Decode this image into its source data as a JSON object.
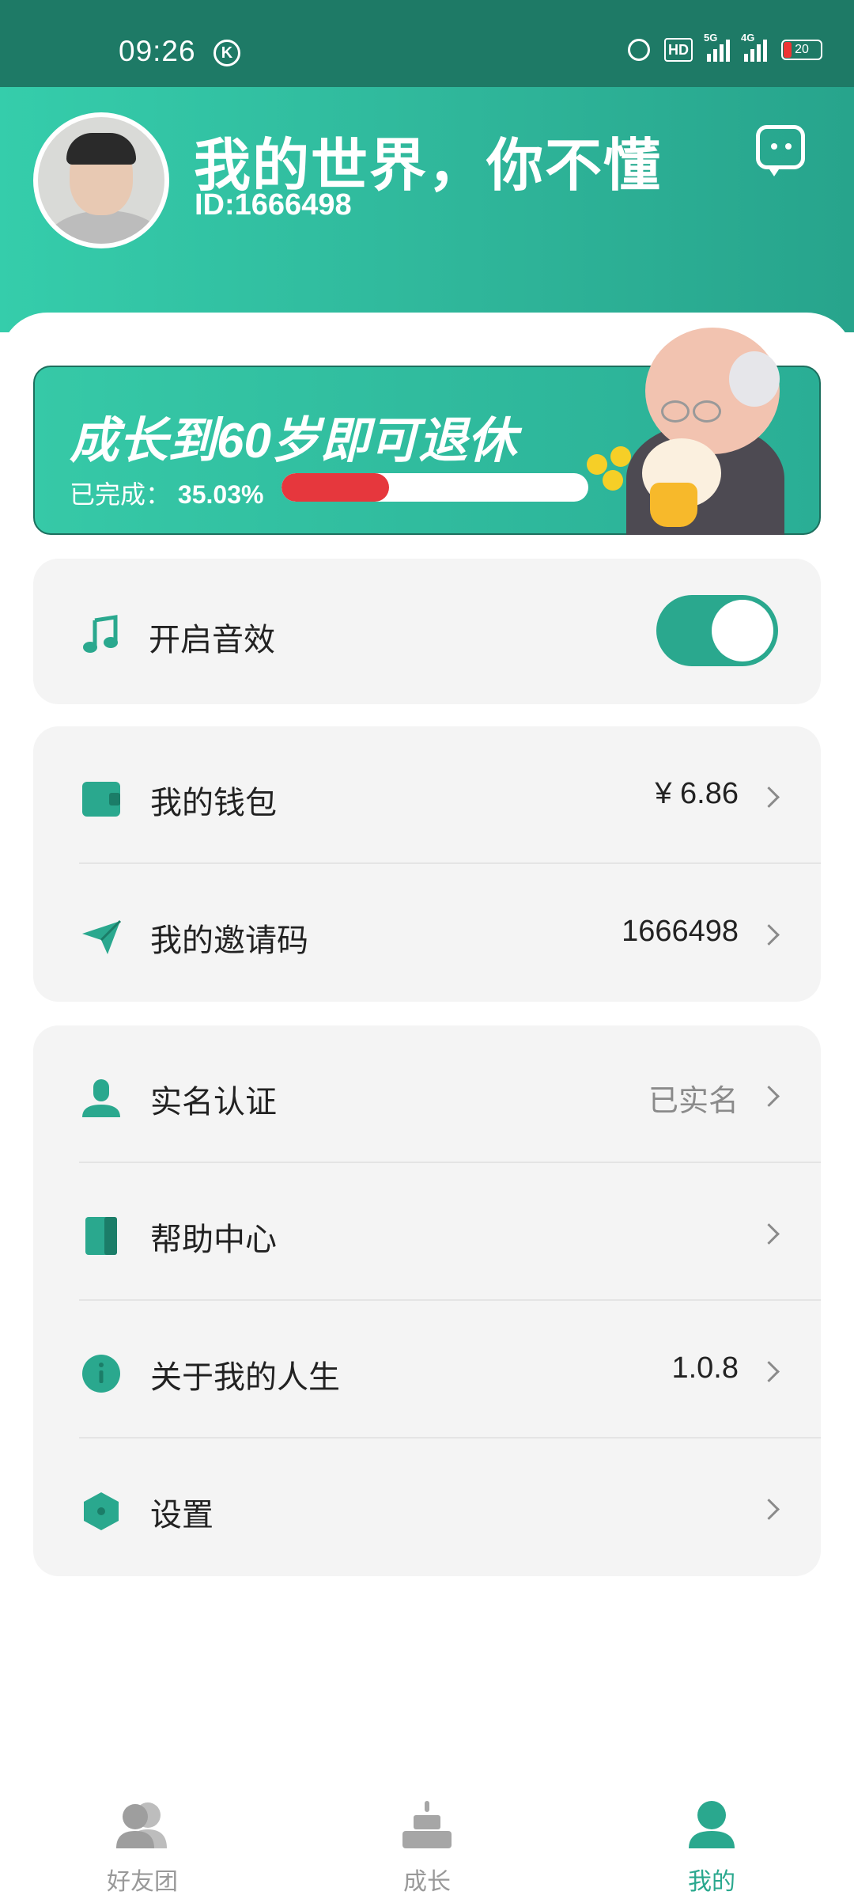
{
  "status_bar": {
    "time": "09:26",
    "hd_label": "HD",
    "signal1_label": "5G",
    "signal2_label": "4G",
    "battery": "20"
  },
  "profile": {
    "name": "我的世界，你不懂",
    "id_text": "ID:1666498"
  },
  "retirement": {
    "title": "成长到60岁即可退休",
    "progress_label": "已完成：",
    "progress_text": "35.03%",
    "progress_fraction": 0.3503
  },
  "sound": {
    "label": "开启音效",
    "enabled": true
  },
  "account": {
    "wallet_label": "我的钱包",
    "wallet_value": "¥ 6.86",
    "invite_label": "我的邀请码",
    "invite_value": "1666498"
  },
  "menu": {
    "realname_label": "实名认证",
    "realname_value": "已实名",
    "help_label": "帮助中心",
    "about_label": "关于我的人生",
    "about_value": "1.0.8",
    "settings_label": "设置"
  },
  "tabs": [
    {
      "label": "好友团",
      "icon": "friends-icon",
      "active": false
    },
    {
      "label": "成长",
      "icon": "cake-icon",
      "active": false
    },
    {
      "label": "我的",
      "icon": "person-icon",
      "active": true
    }
  ],
  "colors": {
    "accent": "#2aa88e",
    "header_gradient_start": "#35cdab",
    "progress_fill": "#e6373d"
  }
}
